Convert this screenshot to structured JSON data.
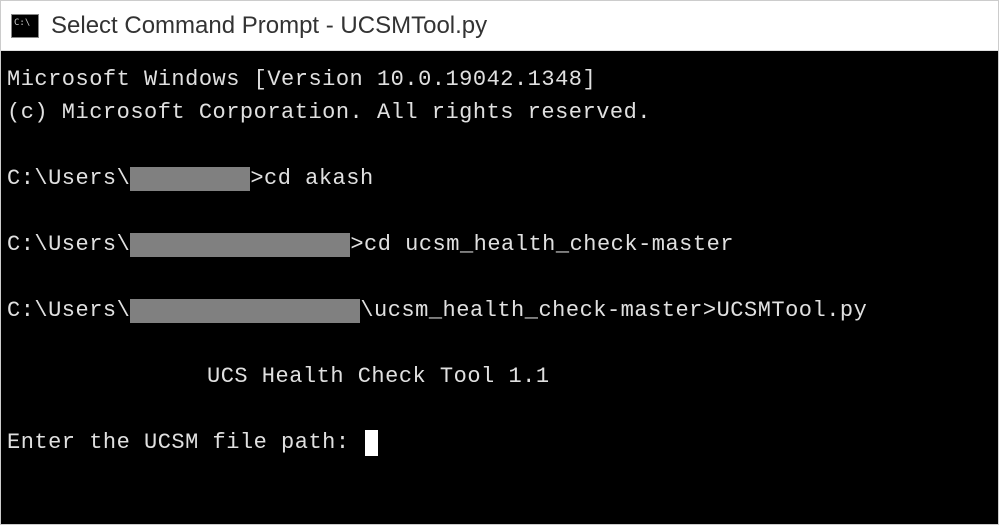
{
  "titlebar": {
    "title": "Select Command Prompt - UCSMTool.py"
  },
  "terminal": {
    "line1": "Microsoft Windows [Version 10.0.19042.1348]",
    "line2": "(c) Microsoft Corporation. All rights reserved.",
    "prompt1_prefix": "C:\\Users\\",
    "prompt1_suffix": ">cd akash",
    "prompt2_prefix": "C:\\Users\\",
    "prompt2_suffix": ">cd ucsm_health_check-master",
    "prompt3_prefix": "C:\\Users\\",
    "prompt3_suffix": "\\ucsm_health_check-master>UCSMTool.py",
    "tool_banner": "UCS Health Check Tool 1.1",
    "input_prompt": "Enter the UCSM file path: "
  }
}
